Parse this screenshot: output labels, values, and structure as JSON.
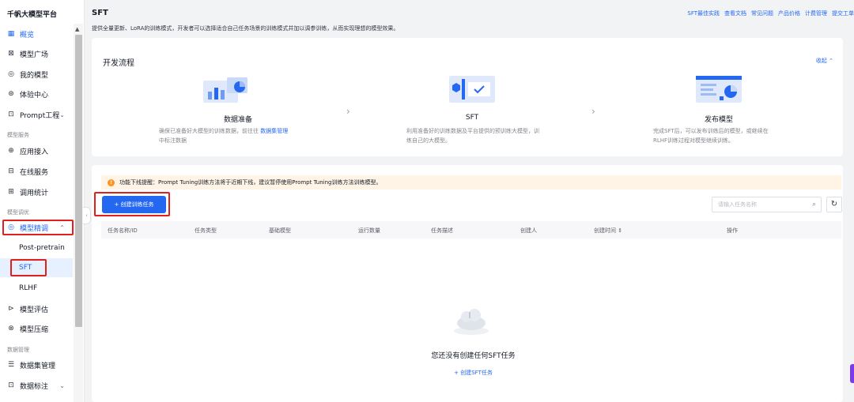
{
  "app": {
    "brand": "千帆大模型平台"
  },
  "sidebar": {
    "items": {
      "overview": {
        "label": "概览"
      },
      "model_plaza": {
        "label": "模型广场"
      },
      "my_models": {
        "label": "我的模型"
      },
      "experience": {
        "label": "体验中心"
      },
      "prompt": {
        "label": "Prompt工程"
      },
      "app_access": {
        "label": "应用接入"
      },
      "online_service": {
        "label": "在线服务"
      },
      "call_stats": {
        "label": "调用统计"
      },
      "finetune": {
        "label": "模型精调"
      },
      "eval": {
        "label": "模型评估"
      },
      "compress": {
        "label": "模型压缩"
      },
      "dataset_mgmt": {
        "label": "数据集管理"
      },
      "data_label": {
        "label": "数据标注"
      }
    },
    "groups": {
      "model_service": "模型服务",
      "model_tuning": "模型调优",
      "data_mgmt": "数据管理"
    },
    "subitems": {
      "post_pretrain": "Post-pretrain",
      "sft": "SFT",
      "rlhf": "RLHF"
    }
  },
  "header": {
    "title": "SFT",
    "description": "提供全量更新、LoRA的训练模式，开发者可以选择适合自己任务场景的训练模式并加以调参训练，从而实现理想的模型效果。",
    "links": [
      "SFT最佳实践",
      "查看文档",
      "常见问题",
      "产品价格",
      "计费管理",
      "提交工单"
    ]
  },
  "flow": {
    "title": "开发流程",
    "collapse": "收起 ⌃",
    "steps": [
      {
        "title": "数据准备",
        "desc_pre": "确保已准备好大模型的训练数据，前往往 ",
        "desc_link": "数据集管理",
        "desc_post": " 中标注数据"
      },
      {
        "title": "SFT",
        "desc": "利用准备好的训练数据及平台提供的预训练大模型，训练自己的大模型。"
      },
      {
        "title": "发布模型",
        "desc": "完成SFT后，可以发布训练后的模型，或继续在RLHF训练过程对模型继续训练。"
      }
    ]
  },
  "tasks": {
    "notice": "功能下线提醒：Prompt Tuning训练方法将于近期下线，建议暂停使用Prompt Tuning训练方法训练模型。",
    "create_button": "+ 创建训练任务",
    "search_placeholder": "请输入任务名称",
    "columns": [
      "任务名称/ID",
      "任务类型",
      "基础模型",
      "运行数量",
      "任务描述",
      "创建人",
      "创建时间  ⇕",
      "操作"
    ],
    "empty_text": "您还没有创建任何SFT任务",
    "empty_link": "+ 创建SFT任务"
  },
  "colors": {
    "accent": "#2468f2",
    "highlight": "#e0201c",
    "notice_bg": "#fff4e6"
  }
}
